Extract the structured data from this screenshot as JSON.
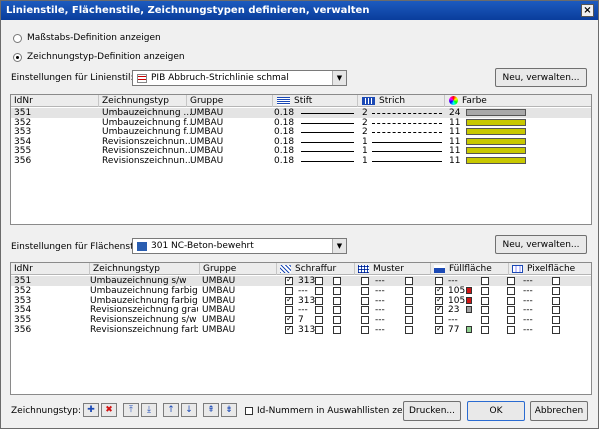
{
  "window": {
    "title": "Linienstile, Flächenstile, Zeichnungstypen definieren, verwalten",
    "close": "×"
  },
  "radios": [
    {
      "label": "Maßstabs-Definition anzeigen",
      "checked": false
    },
    {
      "label": "Zeichnungstyp-Definition anzeigen",
      "checked": true
    }
  ],
  "linienstil": {
    "label": "Einstellungen für Linienstil:",
    "value": "PIB Abbruch-Strichlinie schmal",
    "button": "Neu, verwalten..."
  },
  "lineGrid": {
    "columns": [
      "IdNr",
      "Zeichnungstyp",
      "Gruppe",
      "Stift",
      "Strich",
      "Farbe"
    ],
    "rows": [
      {
        "id": "351",
        "typ": "Umbauzeichnung ...",
        "gruppe": "UMBAU",
        "stift": "0.18",
        "strich": "2",
        "farbe": "24",
        "color": "#a8a8a8",
        "dash": true
      },
      {
        "id": "352",
        "typ": "Umbauzeichnung f...",
        "gruppe": "UMBAU",
        "stift": "0.18",
        "strich": "2",
        "farbe": "11",
        "color": "#c8c800",
        "dash": true
      },
      {
        "id": "353",
        "typ": "Umbauzeichnung f...",
        "gruppe": "UMBAU",
        "stift": "0.18",
        "strich": "2",
        "farbe": "11",
        "color": "#c8c800",
        "dash": true
      },
      {
        "id": "354",
        "typ": "Revisionszeichnun...",
        "gruppe": "UMBAU",
        "stift": "0.18",
        "strich": "1",
        "farbe": "11",
        "color": "#c8c800",
        "dash": false
      },
      {
        "id": "355",
        "typ": "Revisionszeichnun...",
        "gruppe": "UMBAU",
        "stift": "0.18",
        "strich": "1",
        "farbe": "11",
        "color": "#c8c800",
        "dash": false
      },
      {
        "id": "356",
        "typ": "Revisionszeichnun...",
        "gruppe": "UMBAU",
        "stift": "0.18",
        "strich": "1",
        "farbe": "11",
        "color": "#c8c800",
        "dash": false
      }
    ]
  },
  "flaechenstil": {
    "label": "Einstellungen für Flächenstil:",
    "value": "301 NC-Beton-bewehrt",
    "button": "Neu, verwalten..."
  },
  "areaGrid": {
    "columns": [
      "IdNr",
      "Zeichnungstyp",
      "Gruppe",
      "Schraffur",
      "Muster",
      "Füllfläche",
      "Pixelfläche"
    ],
    "rows": [
      {
        "id": "351",
        "typ": "Umbauzeichnung s/w",
        "gruppe": "UMBAU",
        "s_on": true,
        "s_val": "313",
        "m_on": false,
        "m_val": "---",
        "f_on": false,
        "f_val": "---",
        "f_color": "",
        "p_on": false,
        "p_val": "---"
      },
      {
        "id": "352",
        "typ": "Umbauzeichnung farbig",
        "gruppe": "UMBAU",
        "s_on": false,
        "s_val": "---",
        "m_on": false,
        "m_val": "---",
        "f_on": true,
        "f_val": "105",
        "f_color": "#d11414",
        "p_on": false,
        "p_val": "---"
      },
      {
        "id": "353",
        "typ": "Umbauzeichnung farbig / ...",
        "gruppe": "UMBAU",
        "s_on": true,
        "s_val": "313",
        "m_on": false,
        "m_val": "---",
        "f_on": true,
        "f_val": "105",
        "f_color": "#d11414",
        "p_on": false,
        "p_val": "---"
      },
      {
        "id": "354",
        "typ": "Revisionszeichnung grau",
        "gruppe": "UMBAU",
        "s_on": false,
        "s_val": "---",
        "m_on": false,
        "m_val": "---",
        "f_on": true,
        "f_val": "23",
        "f_color": "#a0a0a0",
        "p_on": false,
        "p_val": "---"
      },
      {
        "id": "355",
        "typ": "Revisionszeichnung s/w",
        "gruppe": "UMBAU",
        "s_on": true,
        "s_val": "7",
        "m_on": false,
        "m_val": "---",
        "f_on": false,
        "f_val": "---",
        "f_color": "",
        "p_on": false,
        "p_val": "---"
      },
      {
        "id": "356",
        "typ": "Revisionszeichnung farbig",
        "gruppe": "UMBAU",
        "s_on": true,
        "s_val": "313",
        "m_on": false,
        "m_val": "---",
        "f_on": true,
        "f_val": "77",
        "f_color": "#8fd08f",
        "p_on": false,
        "p_val": "---"
      }
    ]
  },
  "footer": {
    "label": "Zeichnungstyp:",
    "checkbox": "Id-Nummern in Auswahllisten zeigen",
    "print": "Drucken...",
    "ok": "OK",
    "cancel": "Abbrechen",
    "tools": [
      {
        "name": "add-icon",
        "glyph": "✚"
      },
      {
        "name": "delete-icon",
        "glyph": "✖"
      },
      {
        "name": "move-top-icon",
        "glyph": "⤒"
      },
      {
        "name": "move-bottom-icon",
        "glyph": "⤓"
      },
      {
        "name": "move-up-icon",
        "glyph": "↑"
      },
      {
        "name": "move-down-icon",
        "glyph": "↓"
      },
      {
        "name": "import-icon",
        "glyph": "⇞"
      },
      {
        "name": "export-icon",
        "glyph": "⇟"
      }
    ]
  }
}
